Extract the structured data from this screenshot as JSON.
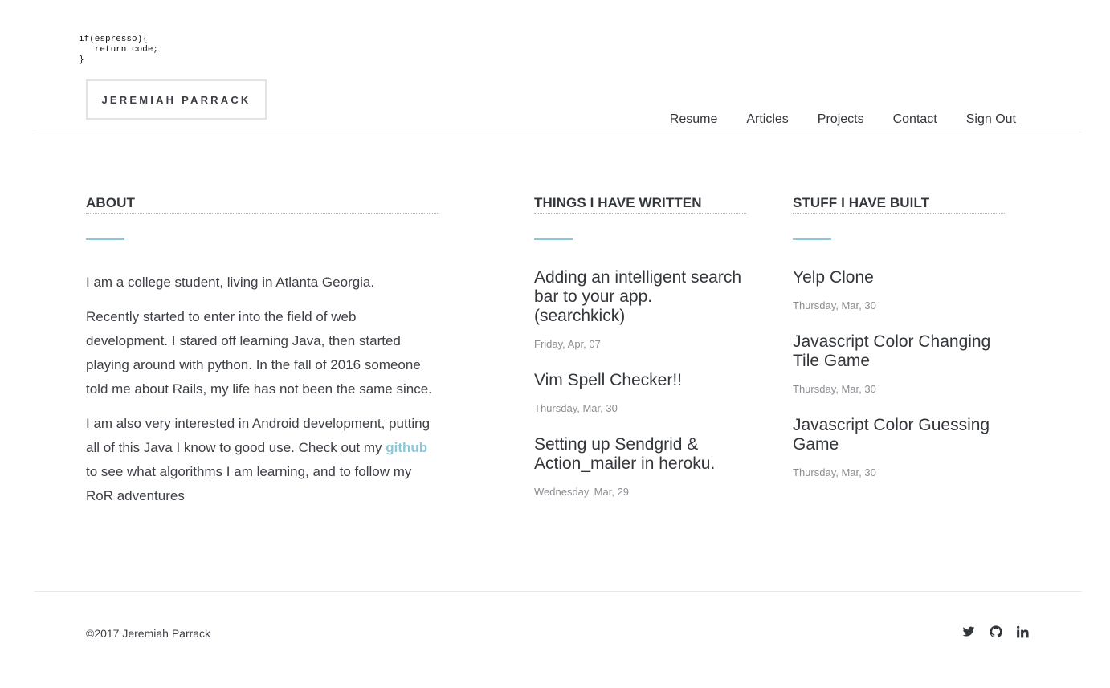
{
  "header": {
    "code_snippet": "if(espresso){\n   return code;\n}",
    "logo": "JEREMIAH PARRACK",
    "nav": [
      {
        "label": "Resume"
      },
      {
        "label": "Articles"
      },
      {
        "label": "Projects"
      },
      {
        "label": "Contact"
      },
      {
        "label": "Sign Out"
      }
    ]
  },
  "about": {
    "title": "ABOUT",
    "p1": "I am a college student, living in Atlanta Georgia.",
    "p2": "Recently started to enter into the field of web development. I stared off learning Java, then started playing around with python. In the fall of 2016 someone told me about Rails, my life has not been the same since.",
    "p3_before": "I am also very interested in Android development, putting all of this Java I know to good use. Check out my ",
    "p3_link": "github",
    "p3_after": " to see what algorithms I am learning, and to follow my RoR adventures"
  },
  "written": {
    "title": "THINGS I HAVE WRITTEN",
    "items": [
      {
        "title": "Adding an intelligent search bar to your app. (searchkick)",
        "date": "Friday, Apr, 07"
      },
      {
        "title": "Vim Spell Checker!!",
        "date": "Thursday, Mar, 30"
      },
      {
        "title": "Setting up Sendgrid & Action_mailer in heroku.",
        "date": "Wednesday, Mar, 29"
      }
    ]
  },
  "built": {
    "title": "STUFF I HAVE BUILT",
    "items": [
      {
        "title": "Yelp Clone",
        "date": "Thursday, Mar, 30"
      },
      {
        "title": "Javascript Color Changing Tile Game",
        "date": "Thursday, Mar, 30"
      },
      {
        "title": "Javascript Color Guessing Game",
        "date": "Thursday, Mar, 30"
      }
    ]
  },
  "footer": {
    "copyright": "©2017 Jeremiah Parrack",
    "social": [
      {
        "icon": "twitter-icon"
      },
      {
        "icon": "github-icon"
      },
      {
        "icon": "linkedin-icon"
      }
    ]
  },
  "colors": {
    "accent": "#8cc6d8",
    "text": "#33363b",
    "muted": "#8a8d91"
  }
}
